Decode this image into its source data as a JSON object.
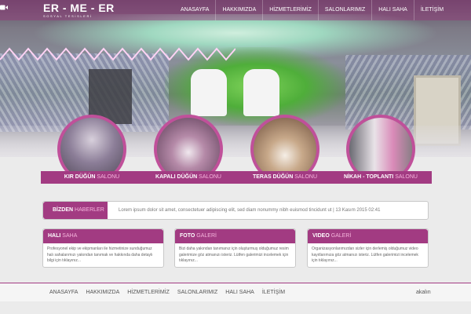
{
  "logo": {
    "brand": "ER - ME - ER",
    "tagline": "SOSYAL TESİSLERİ"
  },
  "nav": {
    "items": [
      "ANASAYFA",
      "HAKKIMIZDA",
      "HİZMETLERİMİZ",
      "SALONLARIMIZ",
      "HALI SAHA",
      "İLETİŞİM"
    ],
    "video_icon": "video-camera-icon"
  },
  "halls": [
    {
      "title": "KIR DÜĞÜN",
      "accent": "SALONU"
    },
    {
      "title": "KAPALI DÜĞÜN",
      "accent": "SALONU"
    },
    {
      "title": "TERAS DÜĞÜN",
      "accent": "SALONU"
    },
    {
      "title": "NİKAH - TOPLANTI",
      "accent": "SALONU"
    }
  ],
  "news": {
    "title": "BİZDEN",
    "accent": "HABERLER",
    "text": "Lorem ipsum dolor sit amet, consectetuer adipiscing elit, sed diam nonummy nibh euismod tincidunt ut | 13 Kasım 2015 02:41"
  },
  "boxes": [
    {
      "title": "HALI",
      "accent": "SAHA",
      "body": "Profesyonel ekip ve ekipmanları ile hizmetinize sunduğumuz halı sahalarımızı yakından tanımak ve hakkında daha detaylı bilgi için tıklayınız..."
    },
    {
      "title": "FOTO",
      "accent": "GALERİ",
      "body": "Bizi daha yakından tanımanız için oluşturmuş olduğumuz resim galerimize göz atmanızı isteriz. Lütfen galerimizi incelemek için tıklayınız..."
    },
    {
      "title": "VIDEO",
      "accent": "GALERİ",
      "body": "Organizasyonlarımızdan sizler için derlemiş olduğumuz video kayıtlarımıza göz atmanızı isteriz. Lütfen galerimizi incelemek için tıklayınız..."
    }
  ],
  "footer": {
    "links": [
      "ANASAYFA",
      "HAKKIMIZDA",
      "HİZMETLERİMİZ",
      "SALONLARIMIZ",
      "HALI SAHA",
      "İLETİŞİM"
    ],
    "credit": "akalın"
  },
  "colors": {
    "primary": "#a23b82",
    "accent_text": "#f7b6de",
    "ring": "#c0509a"
  }
}
